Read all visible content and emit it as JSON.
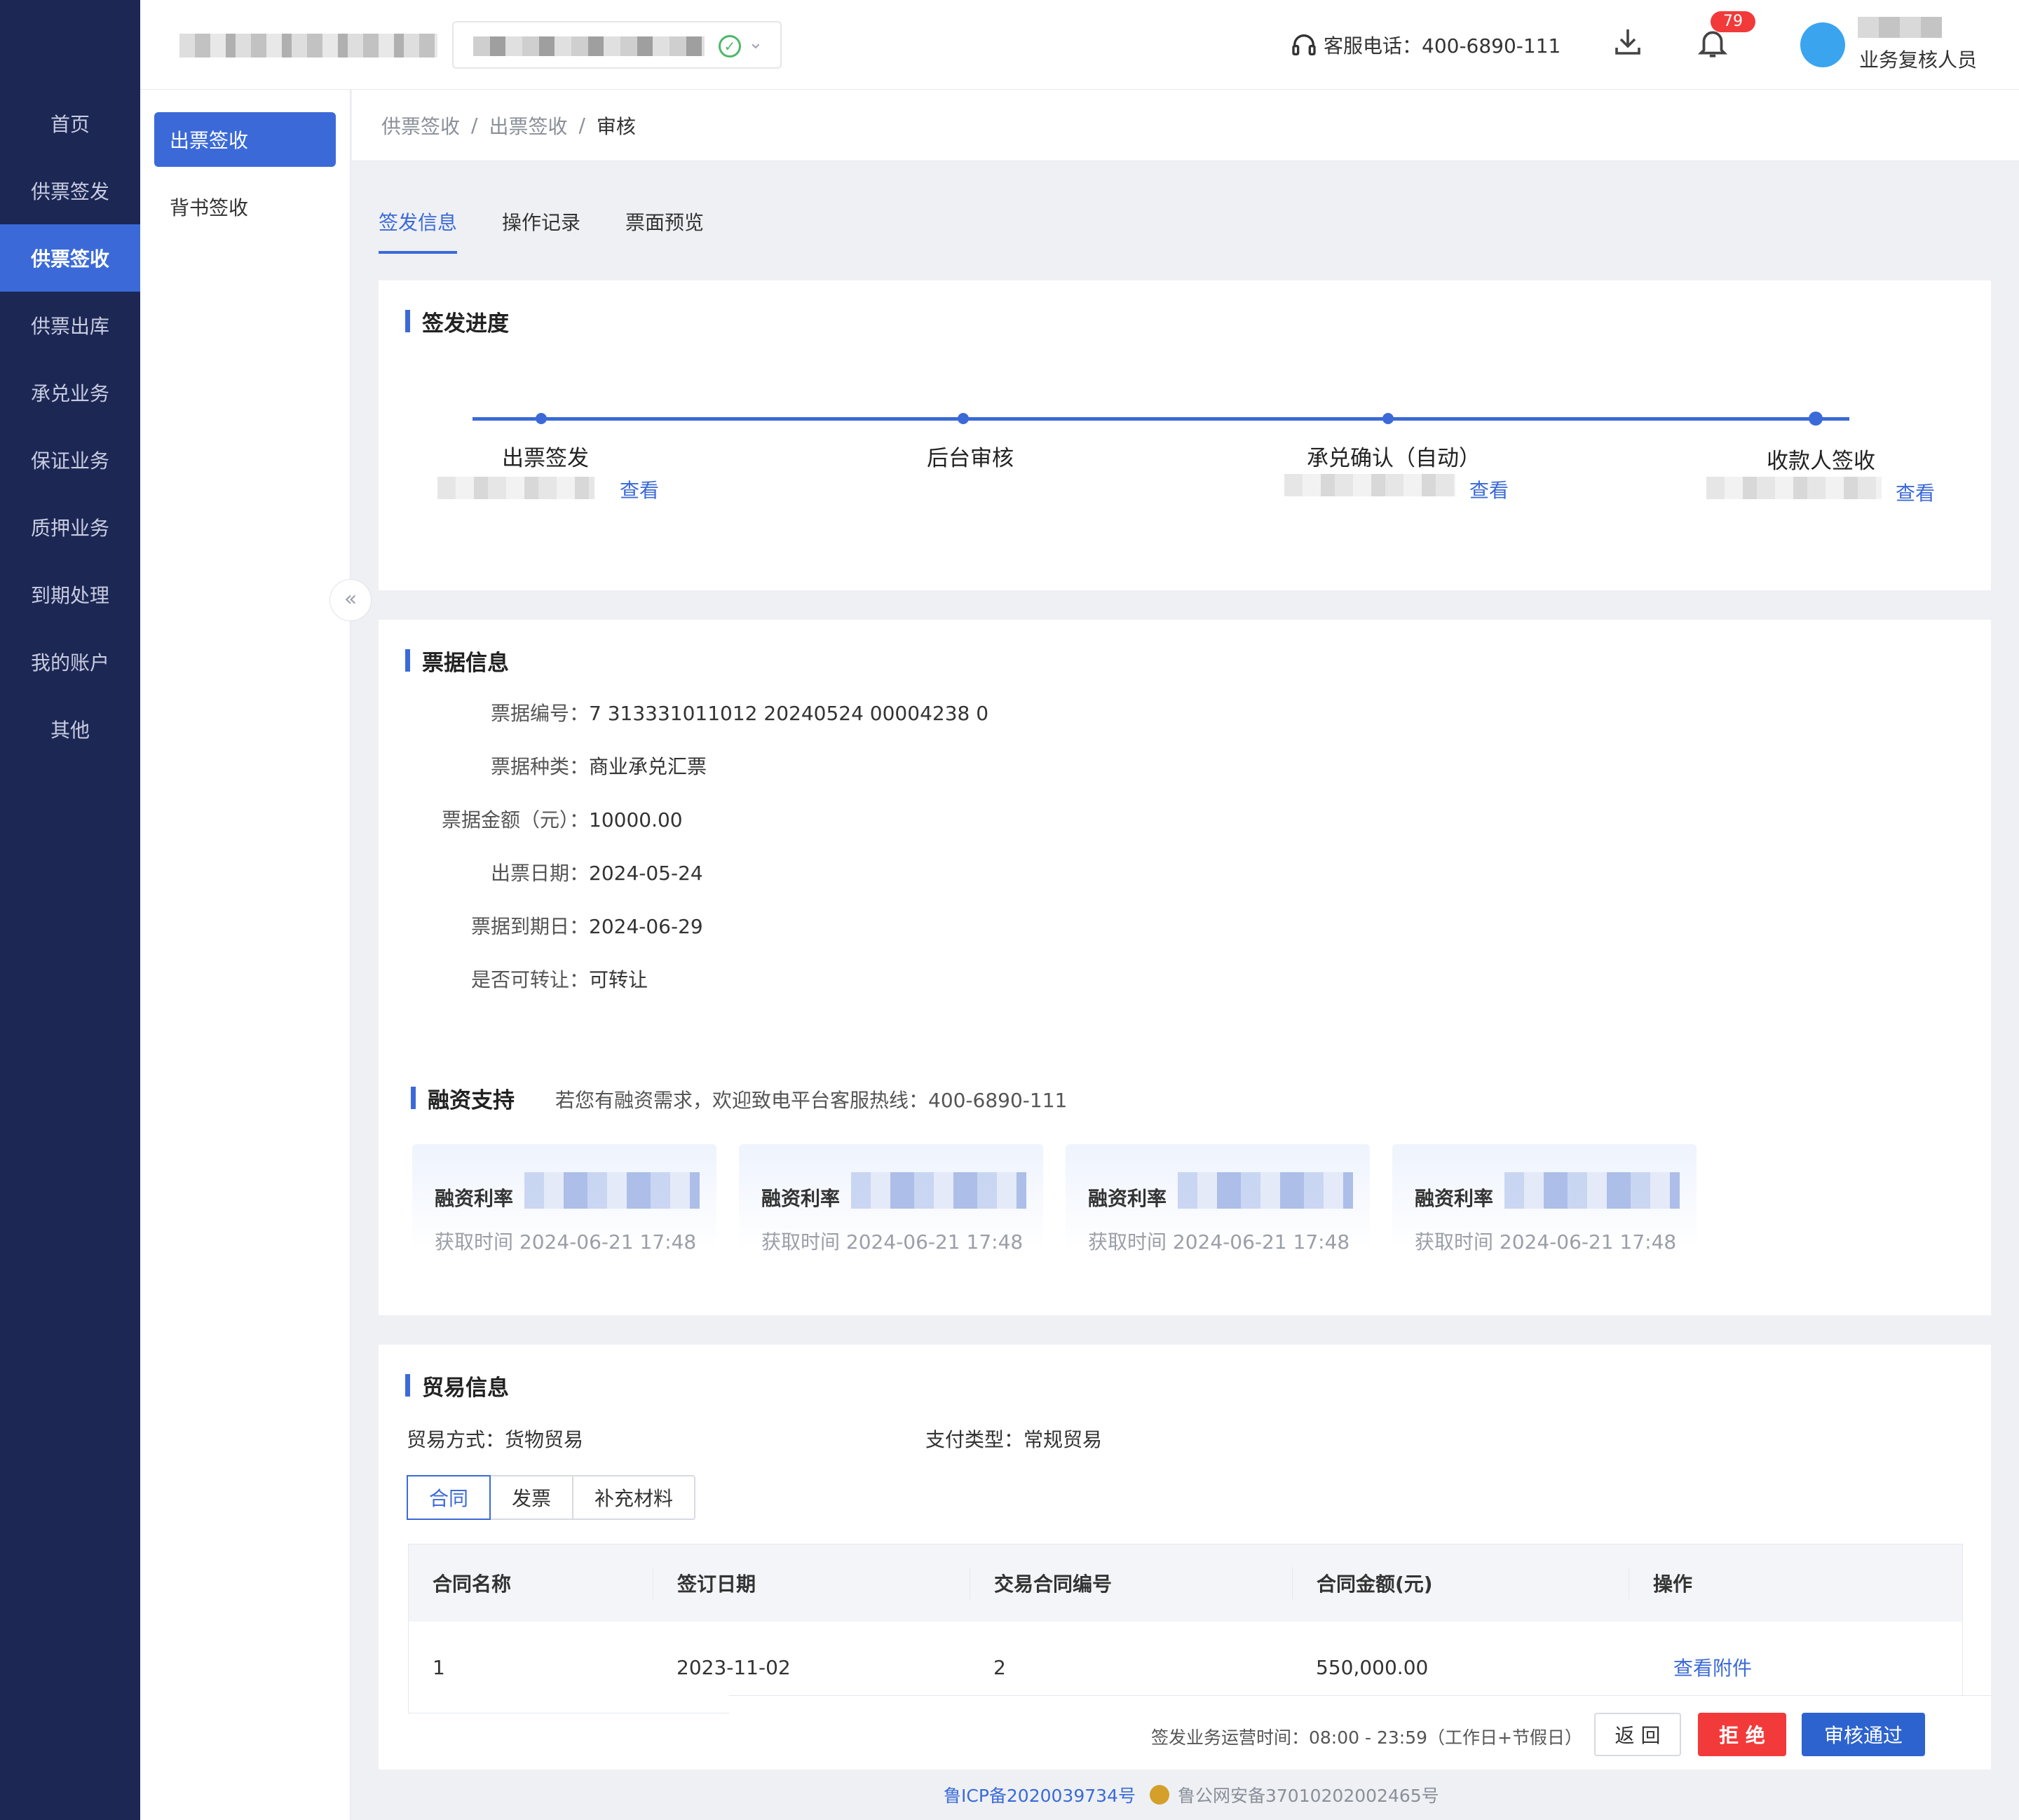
{
  "nav": {
    "items": [
      {
        "label": "首页"
      },
      {
        "label": "供票签发"
      },
      {
        "label": "供票签收"
      },
      {
        "label": "供票出库"
      },
      {
        "label": "承兑业务"
      },
      {
        "label": "保证业务"
      },
      {
        "label": "质押业务"
      },
      {
        "label": "到期处理"
      },
      {
        "label": "我的账户"
      },
      {
        "label": "其他"
      }
    ],
    "active_index": 2
  },
  "topbar": {
    "hotline": "客服电话：400-6890-111",
    "notification_count": "79",
    "user_role": "业务复核人员"
  },
  "subnav": {
    "items": [
      {
        "label": "出票签收"
      },
      {
        "label": "背书签收"
      }
    ]
  },
  "breadcrumb": {
    "items": [
      "供票签收",
      "出票签收",
      "审核"
    ],
    "separator": "/"
  },
  "tabs": [
    {
      "label": "签发信息"
    },
    {
      "label": "操作记录"
    },
    {
      "label": "票面预览"
    }
  ],
  "progress": {
    "title": "签发进度",
    "steps": [
      {
        "label": "出票签发",
        "link": "查看"
      },
      {
        "label": "后台审核"
      },
      {
        "label": "承兑确认（自动）",
        "link": "查看"
      },
      {
        "label": "收款人签收",
        "link": "查看"
      }
    ]
  },
  "bill": {
    "title": "票据信息",
    "fields": [
      {
        "label": "票据编号：",
        "value": "7 313331011012 20240524 00004238 0"
      },
      {
        "label": "票据种类：",
        "value": "商业承兑汇票"
      },
      {
        "label": "票据金额（元）：",
        "value": "10000.00"
      },
      {
        "label": "出票日期：",
        "value": "2024-05-24"
      },
      {
        "label": "票据到期日：",
        "value": "2024-06-29"
      },
      {
        "label": "是否可转让：",
        "value": "可转让"
      }
    ]
  },
  "finance": {
    "title": "融资支持",
    "tip": "若您有融资需求，欢迎致电平台客服热线：400-6890-111",
    "cards": [
      {
        "title": "融资利率",
        "time": "获取时间  2024-06-21 17:48"
      },
      {
        "title": "融资利率",
        "time": "获取时间  2024-06-21 17:48"
      },
      {
        "title": "融资利率",
        "time": "获取时间  2024-06-21 17:48"
      },
      {
        "title": "融资利率",
        "time": "获取时间  2024-06-21 17:48"
      }
    ]
  },
  "trade": {
    "title": "贸易信息",
    "mode": "贸易方式：货物贸易",
    "pay_type": "支付类型：常规贸易",
    "segments": [
      {
        "label": "合同"
      },
      {
        "label": "发票"
      },
      {
        "label": "补充材料"
      }
    ],
    "table": {
      "headers": [
        "合同名称",
        "签订日期",
        "交易合同编号",
        "合同金额(元)",
        "操作"
      ],
      "rows": [
        {
          "name": "1",
          "date": "2023-11-02",
          "no": "2",
          "amount": "550,000.00",
          "action": "查看附件"
        }
      ]
    }
  },
  "footer": {
    "ops_time": "签发业务运营时间：08:00 - 23:59（工作日+节假日）",
    "back": "返 回",
    "reject": "拒 绝",
    "approve": "审核通过",
    "icp": "鲁ICP备2020039734号",
    "gongan": "鲁公网安备37010202002465号"
  },
  "colors": {
    "primary": "#3b6ad8",
    "nav_bg": "#1c2754",
    "danger": "#f23a3a"
  }
}
